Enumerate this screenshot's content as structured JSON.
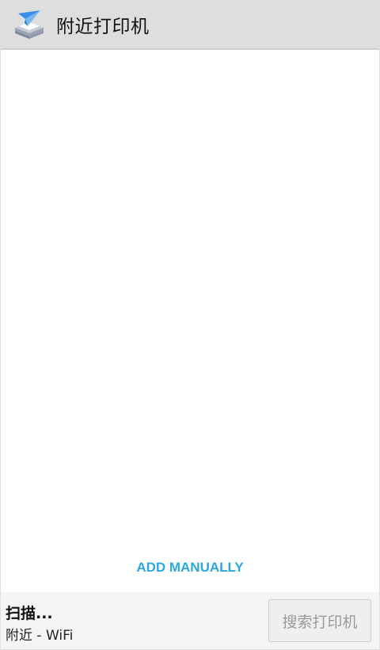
{
  "header": {
    "icon": "printer-paper-plane-icon",
    "title": "附近打印机"
  },
  "list": {
    "add_manually_label": "ADD MANUALLY"
  },
  "footer": {
    "status_title": "扫描...",
    "status_subtitle": "附近 - WiFi",
    "search_button_label": "搜索打印机"
  },
  "colors": {
    "header_bg": "#dedede",
    "accent": "#2aa8df",
    "footer_bg": "#f4f4f4",
    "disabled_text": "#9a9a9a"
  }
}
